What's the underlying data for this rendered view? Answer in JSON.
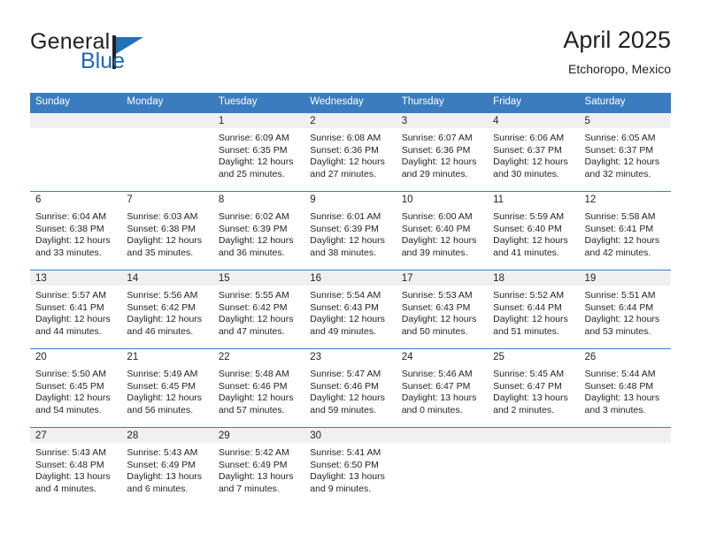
{
  "brand": {
    "name_part1": "General",
    "name_part2": "Blue",
    "logo_icon": "triangle-flag-icon",
    "accent_color": "#2272b8"
  },
  "header": {
    "title": "April 2025",
    "location": "Etchoropo, Mexico"
  },
  "theme": {
    "header_row_bg": "#3b7cbf",
    "daynum_band_bg": "#f0f0f0",
    "row_border": "#3b7cbf",
    "text": "#231f20"
  },
  "calendar": {
    "weekday_headers": [
      "Sunday",
      "Monday",
      "Tuesday",
      "Wednesday",
      "Thursday",
      "Friday",
      "Saturday"
    ],
    "weeks": [
      [
        {
          "day": "",
          "lines": []
        },
        {
          "day": "",
          "lines": []
        },
        {
          "day": "1",
          "lines": [
            "Sunrise: 6:09 AM",
            "Sunset: 6:35 PM",
            "Daylight: 12 hours",
            "and 25 minutes."
          ]
        },
        {
          "day": "2",
          "lines": [
            "Sunrise: 6:08 AM",
            "Sunset: 6:36 PM",
            "Daylight: 12 hours",
            "and 27 minutes."
          ]
        },
        {
          "day": "3",
          "lines": [
            "Sunrise: 6:07 AM",
            "Sunset: 6:36 PM",
            "Daylight: 12 hours",
            "and 29 minutes."
          ]
        },
        {
          "day": "4",
          "lines": [
            "Sunrise: 6:06 AM",
            "Sunset: 6:37 PM",
            "Daylight: 12 hours",
            "and 30 minutes."
          ]
        },
        {
          "day": "5",
          "lines": [
            "Sunrise: 6:05 AM",
            "Sunset: 6:37 PM",
            "Daylight: 12 hours",
            "and 32 minutes."
          ]
        }
      ],
      [
        {
          "day": "6",
          "lines": [
            "Sunrise: 6:04 AM",
            "Sunset: 6:38 PM",
            "Daylight: 12 hours",
            "and 33 minutes."
          ]
        },
        {
          "day": "7",
          "lines": [
            "Sunrise: 6:03 AM",
            "Sunset: 6:38 PM",
            "Daylight: 12 hours",
            "and 35 minutes."
          ]
        },
        {
          "day": "8",
          "lines": [
            "Sunrise: 6:02 AM",
            "Sunset: 6:39 PM",
            "Daylight: 12 hours",
            "and 36 minutes."
          ]
        },
        {
          "day": "9",
          "lines": [
            "Sunrise: 6:01 AM",
            "Sunset: 6:39 PM",
            "Daylight: 12 hours",
            "and 38 minutes."
          ]
        },
        {
          "day": "10",
          "lines": [
            "Sunrise: 6:00 AM",
            "Sunset: 6:40 PM",
            "Daylight: 12 hours",
            "and 39 minutes."
          ]
        },
        {
          "day": "11",
          "lines": [
            "Sunrise: 5:59 AM",
            "Sunset: 6:40 PM",
            "Daylight: 12 hours",
            "and 41 minutes."
          ]
        },
        {
          "day": "12",
          "lines": [
            "Sunrise: 5:58 AM",
            "Sunset: 6:41 PM",
            "Daylight: 12 hours",
            "and 42 minutes."
          ]
        }
      ],
      [
        {
          "day": "13",
          "lines": [
            "Sunrise: 5:57 AM",
            "Sunset: 6:41 PM",
            "Daylight: 12 hours",
            "and 44 minutes."
          ]
        },
        {
          "day": "14",
          "lines": [
            "Sunrise: 5:56 AM",
            "Sunset: 6:42 PM",
            "Daylight: 12 hours",
            "and 46 minutes."
          ]
        },
        {
          "day": "15",
          "lines": [
            "Sunrise: 5:55 AM",
            "Sunset: 6:42 PM",
            "Daylight: 12 hours",
            "and 47 minutes."
          ]
        },
        {
          "day": "16",
          "lines": [
            "Sunrise: 5:54 AM",
            "Sunset: 6:43 PM",
            "Daylight: 12 hours",
            "and 49 minutes."
          ]
        },
        {
          "day": "17",
          "lines": [
            "Sunrise: 5:53 AM",
            "Sunset: 6:43 PM",
            "Daylight: 12 hours",
            "and 50 minutes."
          ]
        },
        {
          "day": "18",
          "lines": [
            "Sunrise: 5:52 AM",
            "Sunset: 6:44 PM",
            "Daylight: 12 hours",
            "and 51 minutes."
          ]
        },
        {
          "day": "19",
          "lines": [
            "Sunrise: 5:51 AM",
            "Sunset: 6:44 PM",
            "Daylight: 12 hours",
            "and 53 minutes."
          ]
        }
      ],
      [
        {
          "day": "20",
          "lines": [
            "Sunrise: 5:50 AM",
            "Sunset: 6:45 PM",
            "Daylight: 12 hours",
            "and 54 minutes."
          ]
        },
        {
          "day": "21",
          "lines": [
            "Sunrise: 5:49 AM",
            "Sunset: 6:45 PM",
            "Daylight: 12 hours",
            "and 56 minutes."
          ]
        },
        {
          "day": "22",
          "lines": [
            "Sunrise: 5:48 AM",
            "Sunset: 6:46 PM",
            "Daylight: 12 hours",
            "and 57 minutes."
          ]
        },
        {
          "day": "23",
          "lines": [
            "Sunrise: 5:47 AM",
            "Sunset: 6:46 PM",
            "Daylight: 12 hours",
            "and 59 minutes."
          ]
        },
        {
          "day": "24",
          "lines": [
            "Sunrise: 5:46 AM",
            "Sunset: 6:47 PM",
            "Daylight: 13 hours",
            "and 0 minutes."
          ]
        },
        {
          "day": "25",
          "lines": [
            "Sunrise: 5:45 AM",
            "Sunset: 6:47 PM",
            "Daylight: 13 hours",
            "and 2 minutes."
          ]
        },
        {
          "day": "26",
          "lines": [
            "Sunrise: 5:44 AM",
            "Sunset: 6:48 PM",
            "Daylight: 13 hours",
            "and 3 minutes."
          ]
        }
      ],
      [
        {
          "day": "27",
          "lines": [
            "Sunrise: 5:43 AM",
            "Sunset: 6:48 PM",
            "Daylight: 13 hours",
            "and 4 minutes."
          ]
        },
        {
          "day": "28",
          "lines": [
            "Sunrise: 5:43 AM",
            "Sunset: 6:49 PM",
            "Daylight: 13 hours",
            "and 6 minutes."
          ]
        },
        {
          "day": "29",
          "lines": [
            "Sunrise: 5:42 AM",
            "Sunset: 6:49 PM",
            "Daylight: 13 hours",
            "and 7 minutes."
          ]
        },
        {
          "day": "30",
          "lines": [
            "Sunrise: 5:41 AM",
            "Sunset: 6:50 PM",
            "Daylight: 13 hours",
            "and 9 minutes."
          ]
        },
        {
          "day": "",
          "lines": []
        },
        {
          "day": "",
          "lines": []
        },
        {
          "day": "",
          "lines": []
        }
      ]
    ]
  }
}
